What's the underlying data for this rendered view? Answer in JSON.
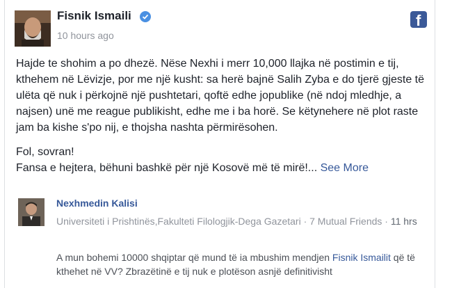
{
  "post": {
    "author": "Fisnik Ismaili",
    "time": "10 hours ago",
    "paragraph1": "Hajde te shohim a po dhezë. Nëse Nexhi i merr 10,000 llajka në postimin e tij, kthehem në Lëvizje, por me një kusht: sa herë bajnë Salih Zyba e do tjerë gjeste të ulëta që nuk i përkojnë një pushtetari, qoftë edhe jopublike (në ndoj mledhje, a najsen) unë me reague publikisht, edhe me i ba horë. Se këtynehere në plot raste jam ba kishe s'po nij, e thojsha nashta përmirësohen.",
    "paragraph2_line1": "Fol, sovran!",
    "paragraph2_line2": "Fansa e hejtera, bëhuni bashkë për një Kosovë më të mirë!...",
    "see_more": "See More"
  },
  "comment": {
    "author": "Nexhmedin Kalisi",
    "meta": "Universiteti i Prishtinës,Fakulteti Filologjik-Dega Gazetari · 7 Mutual Friends · ",
    "hrs": "11 hrs",
    "text_before": "A mun bohemi 10000 shqiptar që mund të ia mbushim mendjen ",
    "mention": "Fisnik Ismailit",
    "text_after": " që të kthehet në VV? Zbrazëtinë e tij nuk e plotëson asnjë definitivisht"
  },
  "icons": {
    "verified": "verified-badge-icon",
    "facebook": "facebook-logo-icon"
  },
  "colors": {
    "link": "#365899",
    "verified": "#4a90e2",
    "facebook": "#3b5998",
    "secondary_text": "#90949c"
  }
}
